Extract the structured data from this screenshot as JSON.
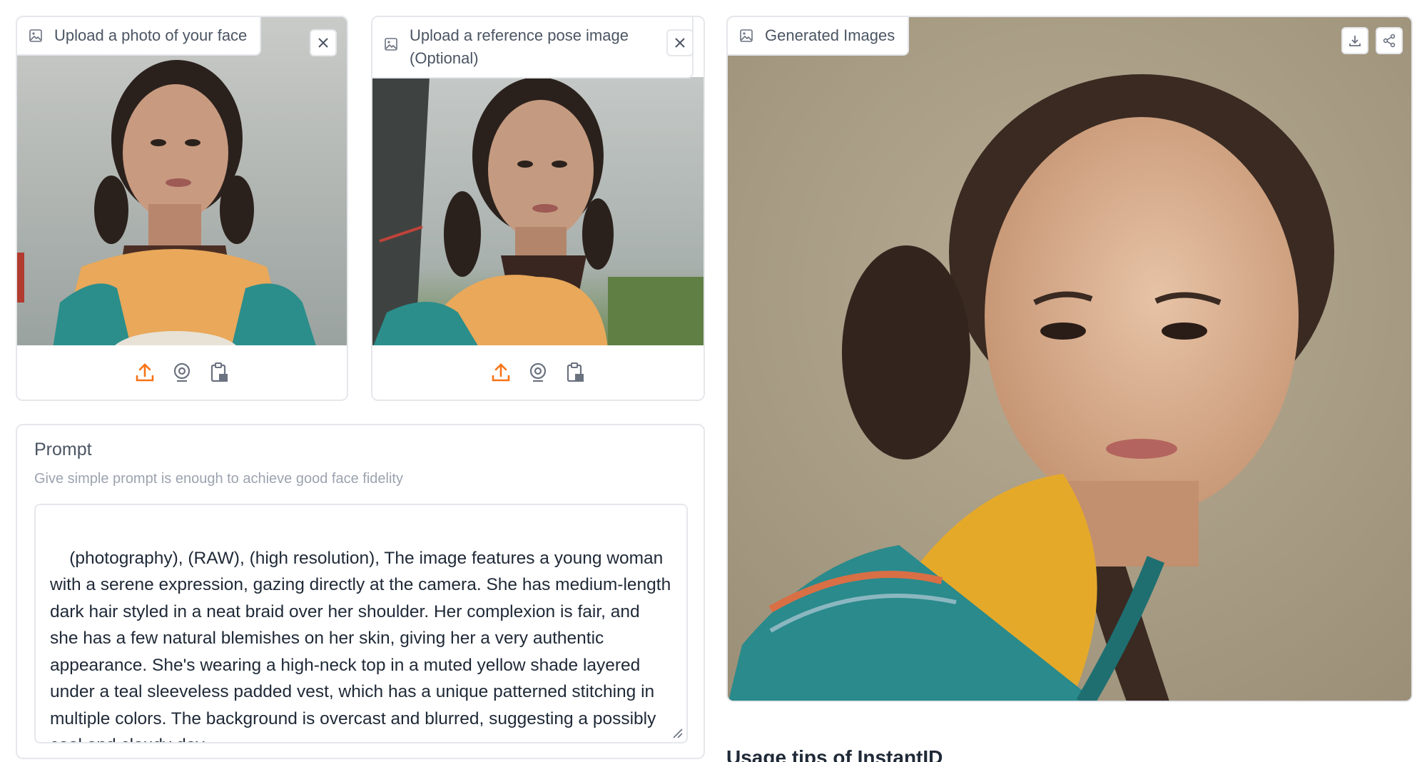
{
  "face_upload": {
    "label": "Upload a photo of your face",
    "icons": [
      "image-icon",
      "close-icon",
      "upload-icon",
      "webcam-icon",
      "clipboard-icon"
    ]
  },
  "pose_upload": {
    "label": "Upload a reference pose image (Optional)",
    "icons": [
      "image-icon",
      "close-icon",
      "upload-icon",
      "webcam-icon",
      "clipboard-icon"
    ]
  },
  "generated": {
    "label": "Generated Images",
    "icons": [
      "image-icon",
      "download-icon",
      "share-icon"
    ]
  },
  "prompt": {
    "label": "Prompt",
    "info": "Give simple prompt is enough to achieve good face fidelity",
    "value": "(photography), (RAW), (high resolution), The image features a young woman with a serene expression, gazing directly at the camera. She has medium-length dark hair styled in a neat braid over her shoulder. Her complexion is fair, and she has a few natural blemishes on her skin, giving her a very authentic appearance. She's wearing a high-neck top in a muted yellow shade layered under a teal sleeveless padded vest, which has a unique patterned stitching in multiple colors. The background is overcast and blurred, suggesting a possibly cool and cloudy day."
  },
  "usage": {
    "title": "Usage tips of InstantID"
  },
  "colors": {
    "accent": "#f97316",
    "border": "#e5e7eb",
    "muted_text": "#9ca3af"
  }
}
